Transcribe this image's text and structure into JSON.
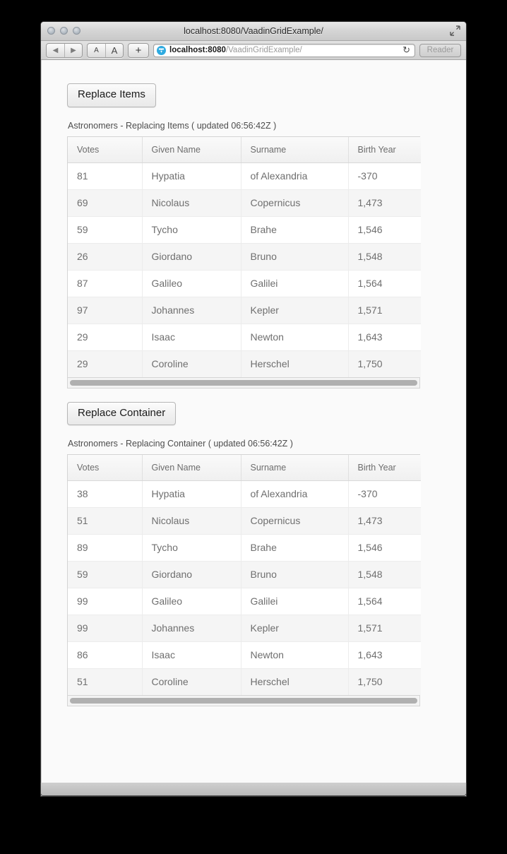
{
  "window": {
    "title": "localhost:8080/VaadinGridExample/",
    "traffic_lights": [
      "close",
      "minimize",
      "zoom"
    ],
    "fullscreen_icon": "fullscreen-arrows-icon"
  },
  "toolbar": {
    "back_icon": "back-arrow-icon",
    "forward_icon": "forward-arrow-icon",
    "text_smaller_label": "A",
    "text_larger_label": "A",
    "add_tab_label": "+",
    "favicon": "vaadin-logo-icon",
    "url_host": "localhost:8080",
    "url_path": "/VaadinGridExample/",
    "reload_icon": "reload-icon",
    "reader_label": "Reader"
  },
  "columns": [
    "Votes",
    "Given Name",
    "Surname",
    "Birth Year"
  ],
  "sections": [
    {
      "button_label": "Replace Items",
      "caption": "Astronomers - Replacing Items ( updated 06:56:42Z )",
      "rows": [
        [
          "81",
          "Hypatia",
          "of Alexandria",
          "-370"
        ],
        [
          "69",
          "Nicolaus",
          "Copernicus",
          "1,473"
        ],
        [
          "59",
          "Tycho",
          "Brahe",
          "1,546"
        ],
        [
          "26",
          "Giordano",
          "Bruno",
          "1,548"
        ],
        [
          "87",
          "Galileo",
          "Galilei",
          "1,564"
        ],
        [
          "97",
          "Johannes",
          "Kepler",
          "1,571"
        ],
        [
          "29",
          "Isaac",
          "Newton",
          "1,643"
        ],
        [
          "29",
          "Coroline",
          "Herschel",
          "1,750"
        ]
      ]
    },
    {
      "button_label": "Replace Container",
      "caption": "Astronomers - Replacing Container ( updated 06:56:42Z )",
      "rows": [
        [
          "38",
          "Hypatia",
          "of Alexandria",
          "-370"
        ],
        [
          "51",
          "Nicolaus",
          "Copernicus",
          "1,473"
        ],
        [
          "89",
          "Tycho",
          "Brahe",
          "1,546"
        ],
        [
          "59",
          "Giordano",
          "Bruno",
          "1,548"
        ],
        [
          "99",
          "Galileo",
          "Galilei",
          "1,564"
        ],
        [
          "99",
          "Johannes",
          "Kepler",
          "1,571"
        ],
        [
          "86",
          "Isaac",
          "Newton",
          "1,643"
        ],
        [
          "51",
          "Coroline",
          "Herschel",
          "1,750"
        ]
      ]
    }
  ],
  "colors": {
    "accent": "#2eaae0",
    "page_bg": "#fafafa",
    "grid_border": "#d4d4d4",
    "row_alt": "#f5f5f5"
  }
}
